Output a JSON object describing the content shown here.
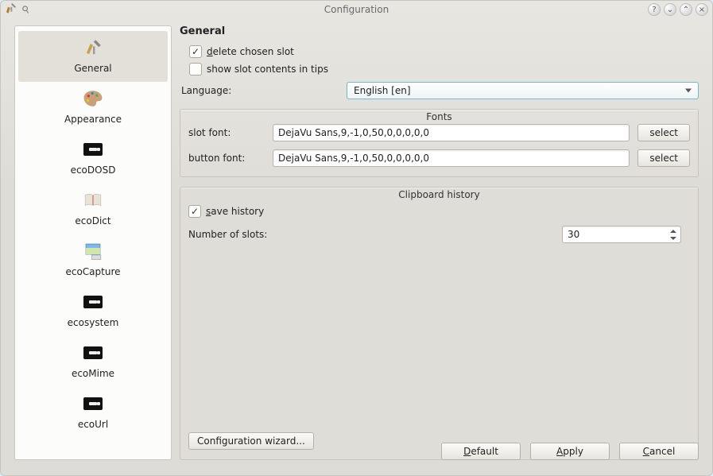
{
  "window": {
    "title": "Configuration"
  },
  "sidebar": {
    "items": [
      {
        "label": "General",
        "selected": true
      },
      {
        "label": "Appearance"
      },
      {
        "label": "ecoDOSD"
      },
      {
        "label": "ecoDict"
      },
      {
        "label": "ecoCapture"
      },
      {
        "label": "ecosystem"
      },
      {
        "label": "ecoMime"
      },
      {
        "label": "ecoUrl"
      }
    ]
  },
  "main": {
    "heading": "General",
    "delete_chosen_label": "delete chosen slot",
    "delete_chosen_checked": true,
    "show_tips_label": "show slot contents in tips",
    "show_tips_checked": false,
    "language_label": "Language:",
    "language_value": "English [en]",
    "fonts": {
      "legend": "Fonts",
      "slot_label": "slot font:",
      "slot_value": "DejaVu Sans,9,-1,0,50,0,0,0,0,0",
      "button_font_label": "button font:",
      "button_font_value": "DejaVu Sans,9,-1,0,50,0,0,0,0,0",
      "select_label": "select"
    },
    "clipboard": {
      "legend": "Clipboard history",
      "save_label": "save history",
      "save_checked": true,
      "slots_label": "Number of slots:",
      "slots_value": "30"
    },
    "wizard_label": "Configuration wizard..."
  },
  "footer": {
    "default_label": "Default",
    "apply_label": "Apply",
    "cancel_label": "Cancel"
  }
}
